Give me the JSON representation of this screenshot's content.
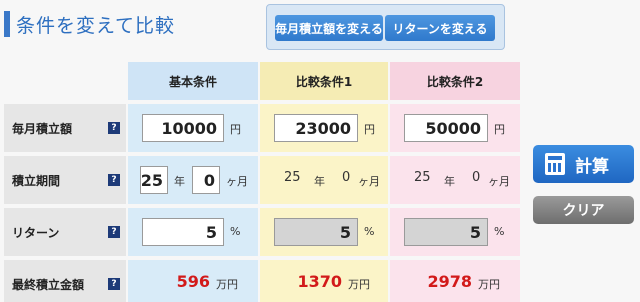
{
  "title": "条件を変えて比較",
  "toggle": {
    "monthly": "毎月積立額を変える",
    "return": "リターンを変える"
  },
  "headers": {
    "base": "基本条件",
    "compare1": "比較条件1",
    "compare2": "比較条件2"
  },
  "help_glyph": "?",
  "rows": {
    "monthly": {
      "label": "毎月積立額",
      "unit": "円",
      "base": "10000",
      "compare1": "23000",
      "compare2": "50000"
    },
    "period": {
      "label": "積立期間",
      "year_unit": "年",
      "month_unit": "ヶ月",
      "base_years": "25",
      "base_months": "0",
      "compare1_years": "25",
      "compare1_months": "0",
      "compare2_years": "25",
      "compare2_months": "0"
    },
    "return": {
      "label": "リターン",
      "unit": "%",
      "base": "5",
      "compare1": "5",
      "compare2": "5"
    },
    "final": {
      "label": "最終積立金額",
      "unit": "万円",
      "base": "596",
      "compare1": "1370",
      "compare2": "2978"
    }
  },
  "buttons": {
    "calculate": "計算",
    "clear": "クリア"
  },
  "colors": {
    "accent": "#2d6fc0",
    "result": "#d21a1a"
  }
}
